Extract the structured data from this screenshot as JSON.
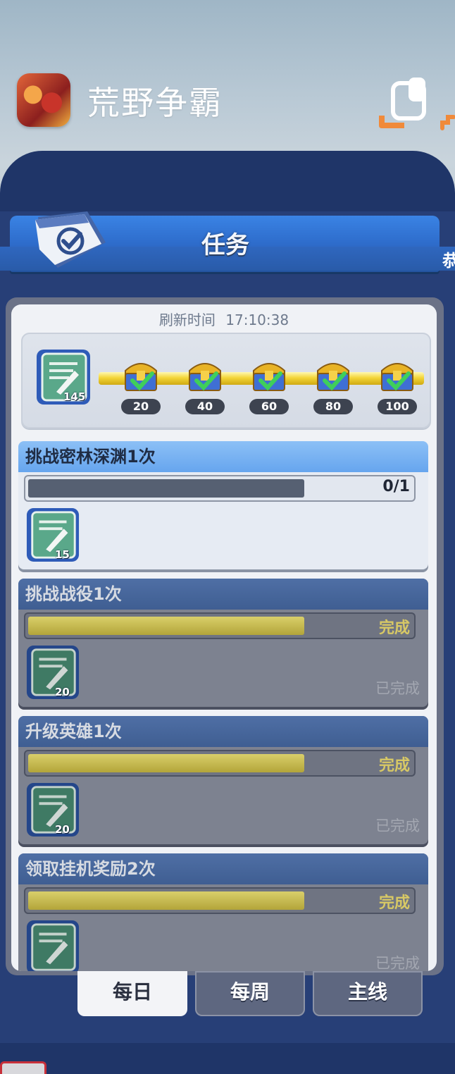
{
  "app": {
    "title": "荒野争霸"
  },
  "panel": {
    "title": "任务",
    "right_edge_text": "恭",
    "refresh_label": "刷新时间",
    "refresh_time": "17:10:38"
  },
  "progress": {
    "points": "145",
    "milestones": [
      {
        "label": "20",
        "claimed": true
      },
      {
        "label": "40",
        "claimed": true
      },
      {
        "label": "60",
        "claimed": true
      },
      {
        "label": "80",
        "claimed": true
      },
      {
        "label": "100",
        "claimed": true
      }
    ]
  },
  "tasks": [
    {
      "title": "挑战密林深渊1次",
      "progress_text": "0/1",
      "progress_fraction": 0.72,
      "reward": "15",
      "status": "",
      "state": "active"
    },
    {
      "title": "挑战战役1次",
      "progress_text": "完成",
      "progress_fraction": 0.72,
      "reward": "20",
      "status": "已完成",
      "state": "done"
    },
    {
      "title": "升级英雄1次",
      "progress_text": "完成",
      "progress_fraction": 0.72,
      "reward": "20",
      "status": "已完成",
      "state": "done"
    },
    {
      "title": "领取挂机奖励2次",
      "progress_text": "完成",
      "progress_fraction": 0.72,
      "reward": "",
      "status": "已完成",
      "state": "done"
    }
  ],
  "tabs": [
    {
      "label": "每日",
      "selected": true
    },
    {
      "label": "每周",
      "selected": false
    },
    {
      "label": "主线",
      "selected": false
    }
  ],
  "colors": {
    "accent_blue": "#3a83e4",
    "done_gold": "#d7c865",
    "frame_dark": "#1f3568"
  }
}
